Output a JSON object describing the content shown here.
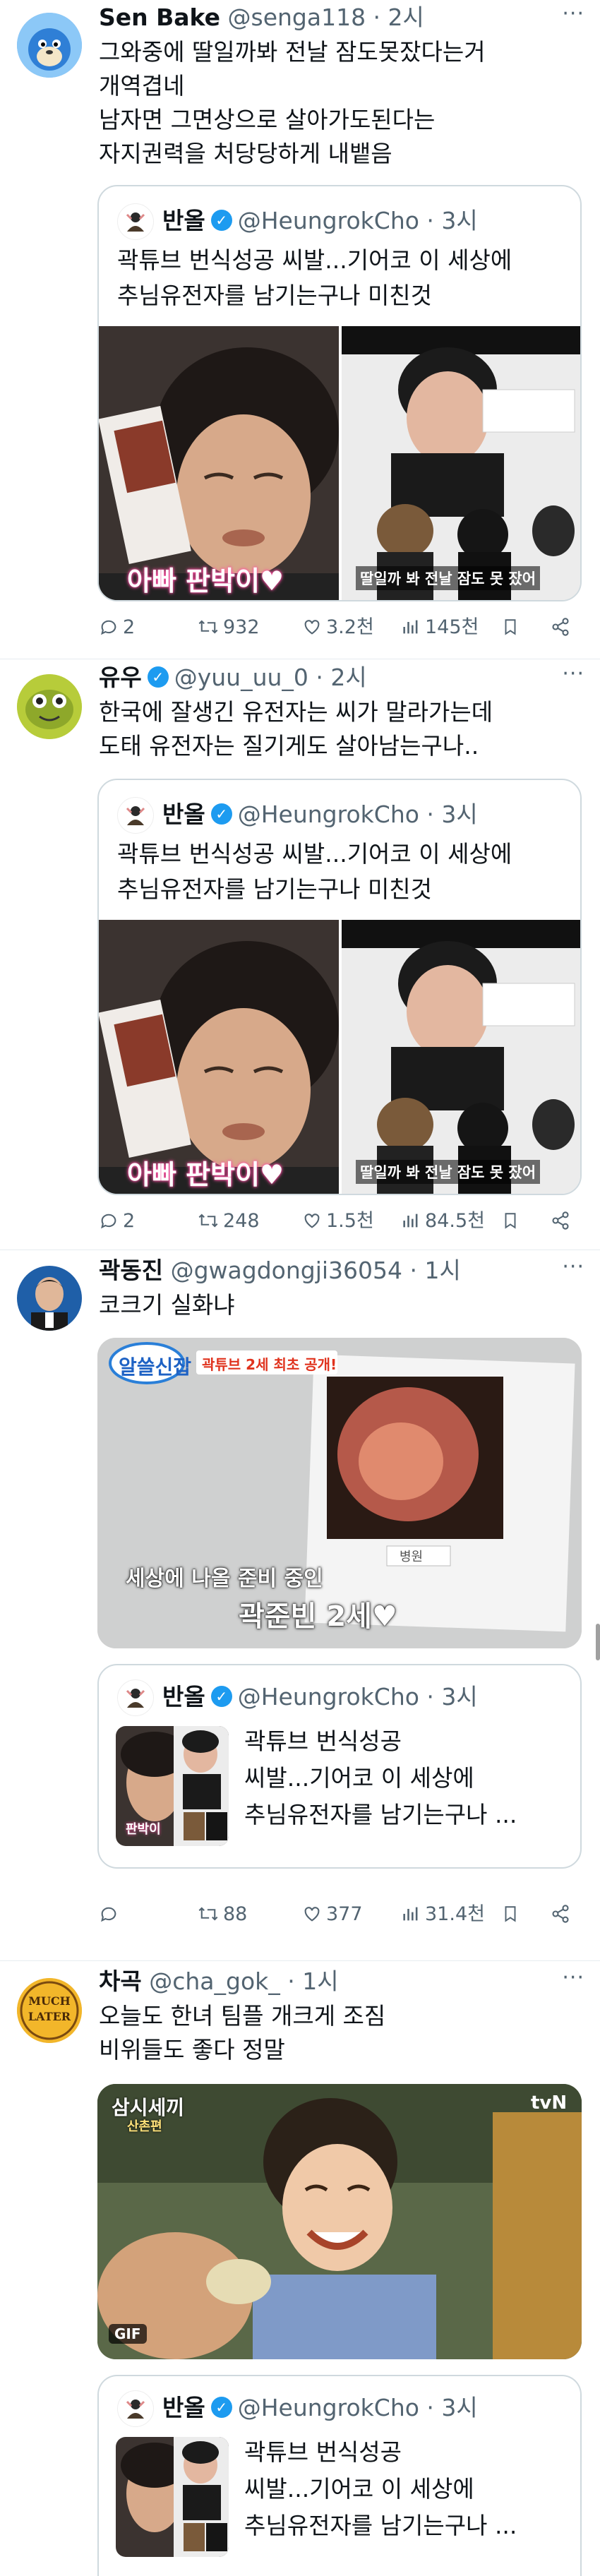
{
  "tweets": [
    {
      "name": "Sen Bake",
      "handle": "@senga118 · 2시",
      "text": "그와중에 딸일까봐 전날 잠도못잤다는거\n개역겹네\n남자면 그면상으로 살아가도된다는\n자지권력을 처당당하게 내뱉음",
      "quote": {
        "name": "반올",
        "handle": "@HeungrokCho · 3시",
        "text": "곽튜브 번식성공 씨발...기어코 이 세상에\n추님유전자를 남기는구나 미친것",
        "caption_left": "아빠 판박이♥",
        "caption_right": "딸일까 봐 전날 잠도 못 잤어"
      },
      "replies": "2",
      "retweets": "932",
      "likes": "3.2천",
      "views": "145천"
    },
    {
      "name": "유우",
      "handle": "@yuu_uu_0 · 2시",
      "text": "한국에 잘생긴 유전자는 씨가 말라가는데\n도태 유전자는 질기게도 살아남는구나..",
      "quote": {
        "name": "반올",
        "handle": "@HeungrokCho · 3시",
        "text": "곽튜브 번식성공 씨발...기어코 이 세상에\n추님유전자를 남기는구나 미친것",
        "caption_left": "아빠 판박이♥",
        "caption_right": "딸일까 봐 전날 잠도 못 잤어"
      },
      "replies": "2",
      "retweets": "248",
      "likes": "1.5천",
      "views": "84.5천"
    },
    {
      "name": "곽동진",
      "handle": "@gwagdongji36054 · 1시",
      "text": "코크기 실화냐",
      "media": {
        "logo": "알쓸신잡",
        "badge": "곽튜브 2세 최초 공개!",
        "caption1": "세상에 나올 준비 중인",
        "caption2": "곽준빈 2세♥",
        "label": "병원"
      },
      "quote": {
        "name": "반올",
        "handle": "@HeungrokCho · 3시",
        "text": "곽튜브 번식성공\n씨발...기어코 이 세상에\n추님유전자를 남기는구나 ...",
        "caption_left": "판박이"
      },
      "replies": "",
      "retweets": "88",
      "likes": "377",
      "views": "31.4천"
    },
    {
      "name": "차곡",
      "handle": "@cha_gok_ · 1시",
      "text": "오늘도 한녀 팀플 개크게 조짐\n비위들도 좋다 정말",
      "avatar_text": "MUCH LATER",
      "media": {
        "title": "삼시세끼",
        "subtitle": "산촌편",
        "network": "tvN",
        "gif": "GIF"
      },
      "quote": {
        "name": "반올",
        "handle": "@HeungrokCho · 3시",
        "text": "곽튜브 번식성공\n씨발...기어코 이 세상에\n추님유전자를 남기는구나 ..."
      }
    }
  ],
  "colors": {
    "text": "#0f1419",
    "secondary": "#536471",
    "border": "#cfd9de",
    "verified": "#1d9bf0",
    "caption_pink": "#ff4fa3"
  },
  "icons": [
    "reply-icon",
    "retweet-icon",
    "like-icon",
    "views-icon",
    "bookmark-icon",
    "share-icon",
    "verified-icon",
    "more-icon"
  ]
}
